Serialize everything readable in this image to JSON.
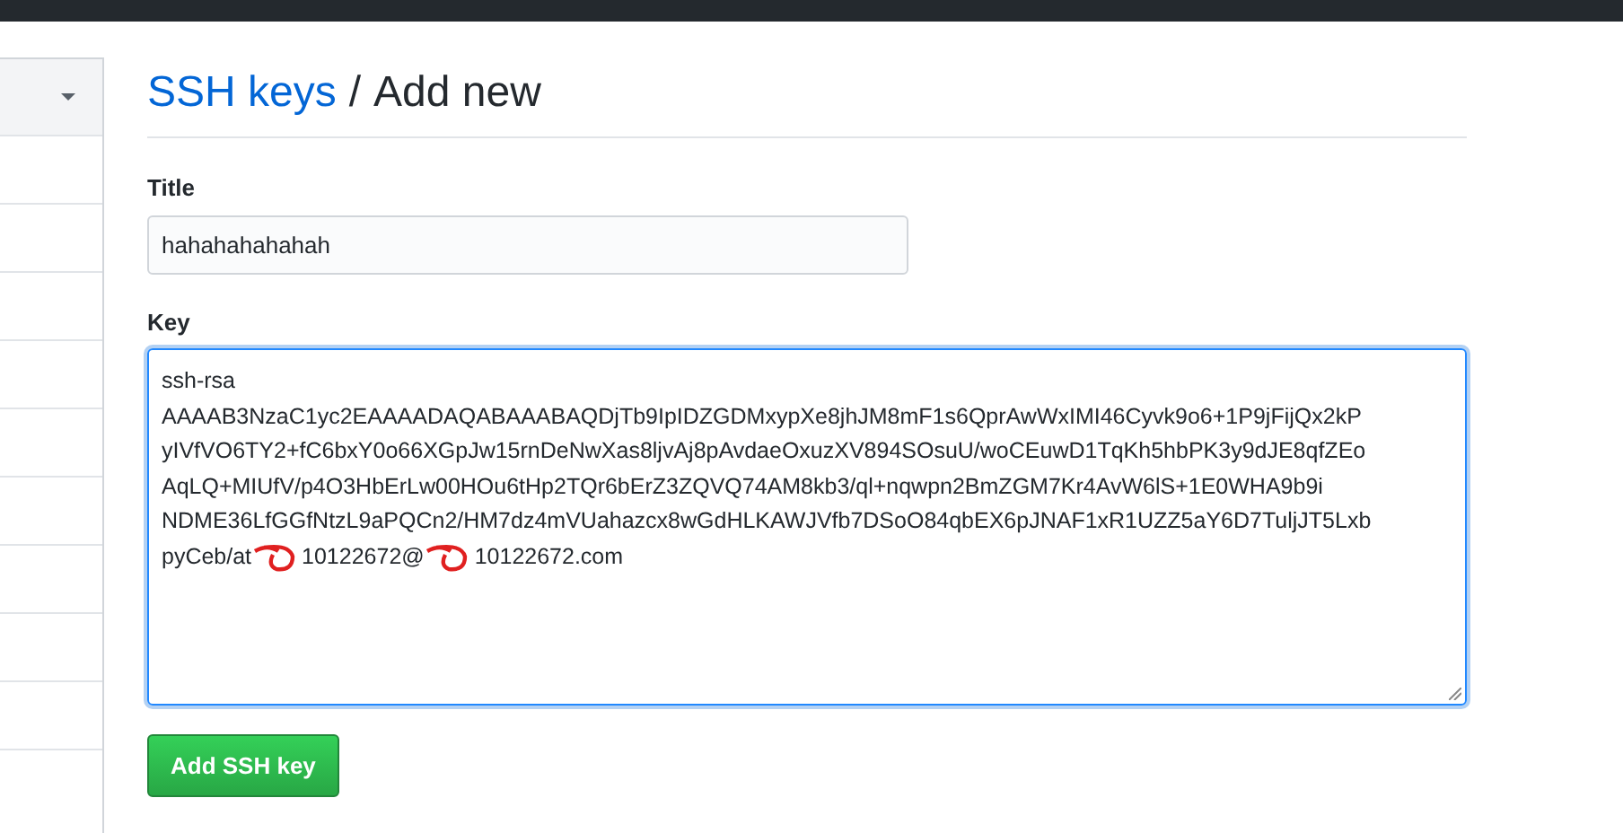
{
  "sidebar": {
    "items": [
      {
        "kind": "dropdown"
      },
      {
        "kind": "row"
      },
      {
        "kind": "row"
      },
      {
        "kind": "row"
      },
      {
        "kind": "row"
      },
      {
        "kind": "row"
      },
      {
        "kind": "row"
      },
      {
        "kind": "row"
      },
      {
        "kind": "row"
      },
      {
        "kind": "row"
      }
    ]
  },
  "breadcrumb": {
    "link": "SSH keys",
    "separator": "/",
    "current": "Add new"
  },
  "title_field": {
    "label": "Title",
    "value": "hahahahahahah"
  },
  "key_field": {
    "label": "Key",
    "lines": [
      "ssh-rsa",
      "AAAAB3NzaC1yc2EAAAADAQABAAABAQDjTb9IpIDZGDMxypXe8jhJM8mF1s6QprAwWxIMI46Cyvk9o6+1P9jFijQx2kP",
      "yIVfVO6TY2+fC6bxY0o66XGpJw15rnDeNwXas8ljvAj8pAvdaeOxuzXV894SOsuU/woCEuwD1TqKh5hbPK3y9dJE8qfZEo",
      "AqLQ+MIUfV/p4O3HbErLw00HOu6tHp2TQr6bErZ3ZQVQ74AM8kb3/ql+nqwpn2BmZGM7Kr4AvW6lS+1E0WHA9b9i",
      "NDME36LfGGfNtzL9aPQCn2/HM7dz4mVUahazcx8wGdHLKAWJVfb7DSoO84qbEX6pJNAF1xR1UZZ5aY6D7TuljJT5Lxb"
    ],
    "last_line_parts": [
      "pyCeb/at",
      "10122672@",
      "10122672.com"
    ]
  },
  "submit_button": "Add SSH key"
}
